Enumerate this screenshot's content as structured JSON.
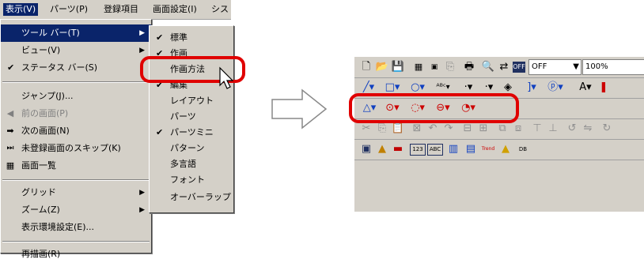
{
  "menubar": {
    "items": [
      "表示(V)",
      "パーツ(P)",
      "登録項目",
      "画面設定(I)",
      "シス"
    ]
  },
  "view_menu": {
    "items": [
      {
        "label": "ツール バー(T)"
      },
      {
        "label": "ビュー(V)"
      },
      {
        "label": "ステータス バー(S)"
      },
      {
        "label": "ジャンプ(J)..."
      },
      {
        "label": "前の画面(P)"
      },
      {
        "label": "次の画面(N)"
      },
      {
        "label": "未登録画面のスキップ(K)"
      },
      {
        "label": "画面一覧"
      },
      {
        "label": "グリッド"
      },
      {
        "label": "ズーム(Z)"
      },
      {
        "label": "表示環境設定(E)..."
      },
      {
        "label": "再描画(R)"
      }
    ]
  },
  "toolbar_submenu": {
    "items": [
      "標準",
      "作画",
      "作画方法",
      "編集",
      "レイアウト",
      "パーツ",
      "パーツミニ",
      "パターン",
      "多言語",
      "フォント",
      "オーバーラップ"
    ]
  },
  "toolbars": {
    "snap_combo": "OFF",
    "zoom_combo": "100%",
    "overlay_logo": "OFF",
    "icons": [
      [
        "new-file",
        "open-folder",
        "save",
        "grid-snap",
        "sim",
        "copy-page",
        "print",
        "find",
        "find-replace",
        "overlay-toggle"
      ],
      [
        "line",
        "rectangle",
        "circle",
        "text",
        "dot",
        "tile",
        "bracket",
        "parts",
        "text-A",
        "color"
      ],
      [
        "polygon",
        "circle-center",
        "arc",
        "ellipse",
        "sector"
      ],
      [
        "cut",
        "copy",
        "paste",
        "delete",
        "undo",
        "redo",
        "align-left",
        "align-right",
        "group",
        "ungroup",
        "rotate"
      ],
      [
        "switch",
        "lamp",
        "data-display",
        "numeric",
        "char-display",
        "graph",
        "bar-chart",
        "trend",
        "alarm",
        "message"
      ]
    ],
    "text_icons": [
      "ABc",
      "123",
      "ABC",
      "Trend",
      "DB"
    ]
  },
  "colors": {
    "menu_bg": "#d4d0c8",
    "highlight": "#0a246a",
    "outline": "#e00000"
  }
}
